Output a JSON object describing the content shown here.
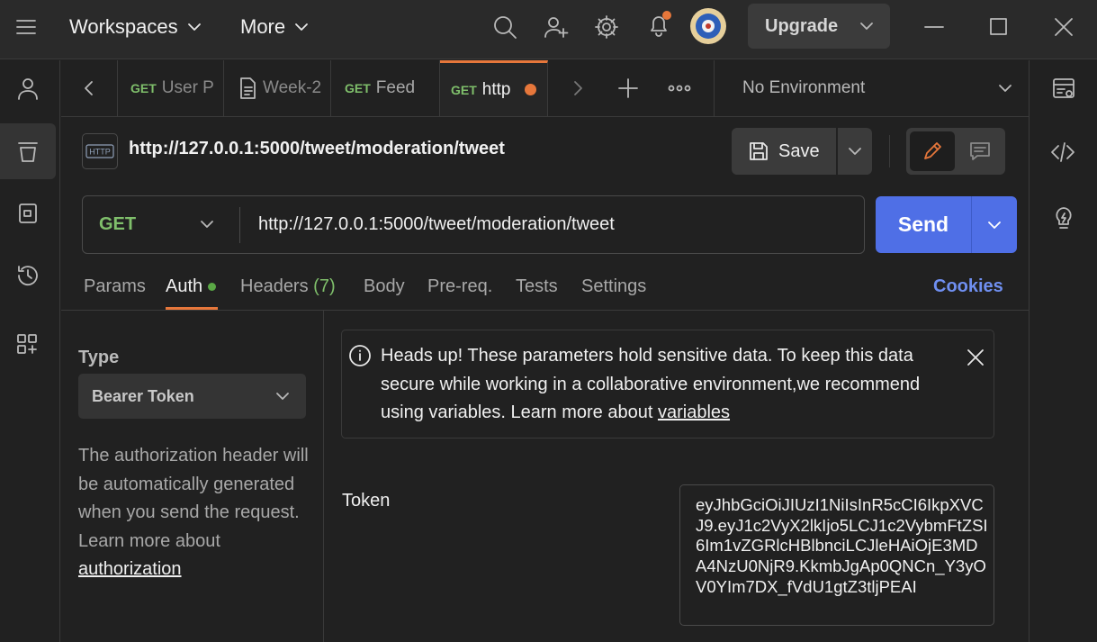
{
  "topbar": {
    "workspaces_label": "Workspaces",
    "more_label": "More",
    "upgrade_label": "Upgrade",
    "icons": [
      "search-icon",
      "invite-user-icon",
      "settings-icon",
      "bell-icon",
      "avatar",
      "minimize-icon",
      "maximize-icon",
      "close-icon"
    ],
    "accent_color": "#e6773b"
  },
  "sidebar": {
    "items": [
      "collections-icon",
      "apis-icon",
      "mock-servers-icon",
      "history-icon",
      "add-widget-icon"
    ],
    "user_icon": "user-icon"
  },
  "tabs": [
    {
      "method": "GET",
      "label": "User P"
    },
    {
      "method": "",
      "label": "Week-2"
    },
    {
      "method": "GET",
      "label": "Feed"
    },
    {
      "method": "GET",
      "label": "http",
      "unsaved": true
    }
  ],
  "environment": {
    "selected": "No Environment"
  },
  "request": {
    "title": "http://127.0.0.1:5000/tweet/moderation/tweet",
    "save_label": "Save",
    "method": "GET",
    "url": "http://127.0.0.1:5000/tweet/moderation/tweet",
    "send_label": "Send"
  },
  "subtabs": {
    "params": "Params",
    "auth": "Auth",
    "headers": "Headers",
    "headers_count": "(7)",
    "body": "Body",
    "prereq": "Pre-req.",
    "tests": "Tests",
    "settings": "Settings",
    "cookies": "Cookies"
  },
  "auth": {
    "type_label": "Type",
    "type_value": "Bearer Token",
    "description": "The authorization header will be automatically generated when you send the request. Learn more about ",
    "description_link": "authorization",
    "warning": "Heads up! These parameters hold sensitive data. To keep this data secure while working in a collaborative environment,we recommend using variables. Learn more about ",
    "warning_link": "variables",
    "token_label": "Token",
    "token_value": "eyJhbGciOiJIUzI1NiIsInR5cCI6IkpXVCJ9.eyJ1c2VyX2lkIjo5LCJ1c2VybmFtZSI6Im1vZGRlcHBlbnciLCJleHAiOjE3MDA4NzU0NjR9.KkmbJgAp0QNCn_Y3yOV0YIm7DX_fVdU1gtZ3tljPEAI"
  },
  "colors": {
    "send": "#4f6fe6",
    "get_method": "#7fbf6b",
    "cookies": "#6f8ff0",
    "headers_count": "#7fbf6b"
  }
}
